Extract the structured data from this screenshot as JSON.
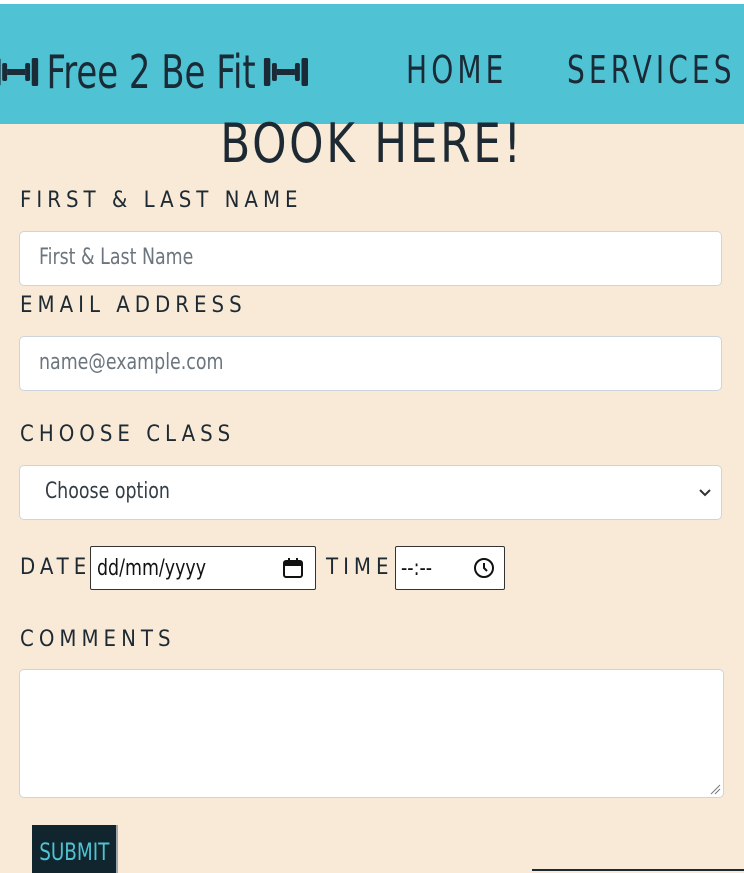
{
  "nav": {
    "brand": "Free 2 Be Fit",
    "items": [
      "HOME",
      "SERVICES"
    ]
  },
  "form": {
    "heading": "BOOK HERE!",
    "name_label": "FIRST & LAST NAME",
    "name_placeholder": "First & Last Name",
    "email_label": "EMAIL ADDRESS",
    "email_placeholder": "name@example.com",
    "class_label": "CHOOSE CLASS",
    "class_selected": "Choose option",
    "date_label": "DATE",
    "date_value": "dd/mm/yyyy",
    "time_label": "TIME",
    "time_value": "--:--",
    "comments_label": "COMMENTS",
    "submit_label": "SUBMIT"
  },
  "icons": {
    "brand_left": "dumbbell-icon",
    "brand_right": "dumbbell-icon",
    "select": "chevron-down-icon",
    "date": "calendar-icon",
    "time": "clock-icon",
    "textarea": "resize-handle-icon"
  },
  "colors": {
    "navbar": "#4fc3d4",
    "page": "#f9ead7",
    "text": "#1e2a33",
    "submit_bg": "#10252d",
    "submit_text": "#4fc3d4"
  }
}
